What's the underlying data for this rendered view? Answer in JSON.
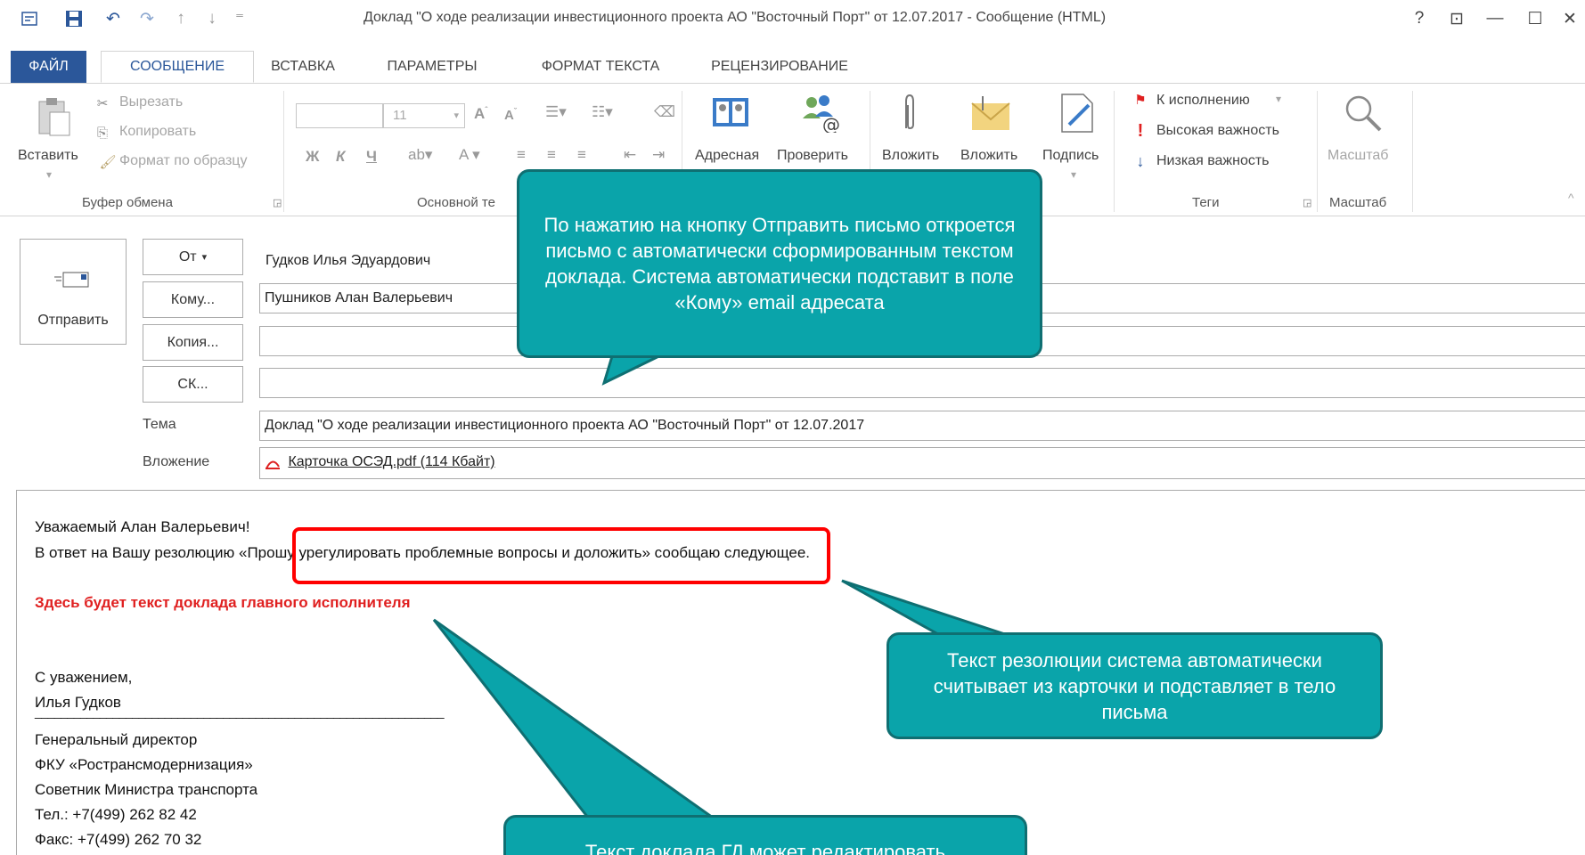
{
  "window": {
    "title": "Доклад \"О ходе реализации инвестиционного проекта АО \"Восточный Порт\" от 12.07.2017 - Сообщение (HTML)",
    "help": "?",
    "restore_ribbon": "⊡",
    "minimize": "—",
    "maximize": "☐",
    "close": "✕"
  },
  "quick_access": {
    "save": "💾",
    "undo": "↶",
    "redo": "↷",
    "up": "↑",
    "down": "↓",
    "customize": "⁼"
  },
  "tabs": [
    "Файл",
    "Сообщение",
    "Вставка",
    "Параметры",
    "Формат текста",
    "Рецензирование"
  ],
  "ribbon": {
    "clipboard": {
      "paste": "Вставить",
      "cut": "Вырезать",
      "copy": "Копировать",
      "format_painter": "Формат по образцу",
      "group": "Буфер обмена"
    },
    "basic_text": {
      "font_size": "11",
      "bold": "Ж",
      "italic": "К",
      "underline": "Ч",
      "group": "Основной те"
    },
    "names": {
      "address_book": "Адресная",
      "check_names": "Проверить"
    },
    "include": {
      "attach_file": "Вложить",
      "attach_item": "Вложить",
      "signature": "Подпись"
    },
    "tags": {
      "followup": "К исполнению",
      "high": "Высокая важность",
      "low": "Низкая важность",
      "group": "Теги"
    },
    "zoom": {
      "button": "Масштаб",
      "group": "Масштаб"
    }
  },
  "header": {
    "send": "Отправить",
    "from_btn": "От",
    "from_value": "Гудков Илья Эдуардович",
    "to_btn": "Кому...",
    "to_value": "Пушников Алан Валерьевич",
    "cc_btn": "Копия...",
    "bcc_btn": "СК...",
    "subject_label": "Тема",
    "subject_value": "Доклад \"О ходе реализации инвестиционного проекта АО \"Восточный Порт\" от 12.07.2017",
    "attachment_label": "Вложение",
    "attachment_value": "Карточка ОСЭД.pdf (114 Кбайт)"
  },
  "body": {
    "greeting": "Уважаемый Алан Валерьевич!",
    "reply_prefix": "В ответ на Вашу резолюцию ",
    "resolution": "«Прошу урегулировать проблемные вопросы и доложить»",
    "reply_suffix": " сообщаю следующее.",
    "placeholder": "Здесь будет текст доклада главного исполнителя",
    "regards": "С уважением,",
    "signer": "Илья Гудков",
    "rule": "_______________________________________________________________",
    "position": "Генеральный директор",
    "org": "ФКУ «Ространсмодернизация»",
    "advisor": "Советник Министра транспорта",
    "phone": "Тел.:  +7(499) 262 82 42",
    "fax": "Факс: +7(499)  262 70 32"
  },
  "callouts": {
    "top": "По нажатию на кнопку Отправить письмо откроется письмо с автоматически сформированным текстом доклада. Система автоматически подставит в поле «Кому» email адресата",
    "right": "Текст резолюции система автоматически считывает из карточки и подставляет в тело письма",
    "bottom": "Текст доклада ГД может редактировать"
  },
  "colors": {
    "accent": "#2b579a",
    "callout": "#0aa4aa",
    "callout_border": "#0f6f72",
    "highlight": "#ff0000",
    "red_text": "#e02020"
  }
}
